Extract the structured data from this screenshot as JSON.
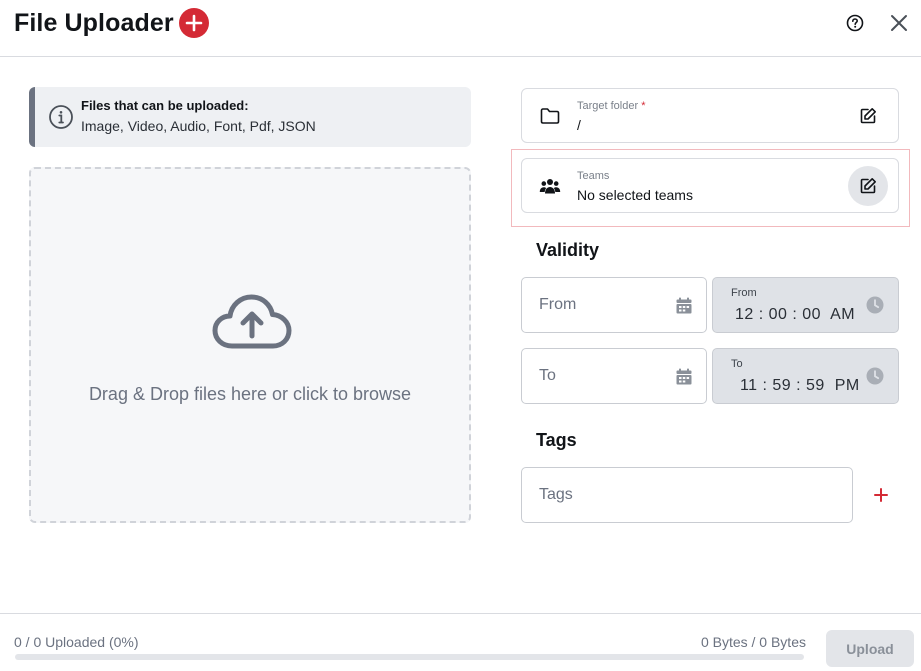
{
  "header": {
    "title": "File Uploader"
  },
  "info": {
    "title": "Files that can be uploaded:",
    "types": "Image, Video, Audio, Font, Pdf, JSON"
  },
  "dropzone": {
    "text": "Drag & Drop files here or click to browse"
  },
  "target_folder": {
    "label": "Target folder",
    "required_mark": "*",
    "value": "/"
  },
  "teams": {
    "label": "Teams",
    "value": "No selected teams"
  },
  "validity": {
    "title": "Validity",
    "from_placeholder": "From",
    "from_time_label": "From",
    "from_time": "12 : 00 : 00  AM",
    "to_placeholder": "To",
    "to_time_label": "To",
    "to_time": " 11 : 59 : 59  PM"
  },
  "tags": {
    "title": "Tags",
    "placeholder": "Tags",
    "add_symbol": "+"
  },
  "footer": {
    "progress_text": "0 / 0 Uploaded (0%)",
    "progress_fraction": 0,
    "bytes_text": "0 Bytes / 0 Bytes",
    "upload_label": "Upload"
  },
  "colors": {
    "accent": "#d42a35",
    "disabled_bg": "#e3e5e9",
    "muted_text": "#6b7280"
  },
  "icons": {
    "add": "plus-circle-icon",
    "help": "help-circle-icon",
    "close": "close-icon",
    "info": "info-icon",
    "upload": "cloud-upload-icon",
    "folder": "folder-icon",
    "teams": "users-icon",
    "edit": "edit-icon",
    "calendar": "calendar-icon",
    "clock": "clock-icon"
  }
}
